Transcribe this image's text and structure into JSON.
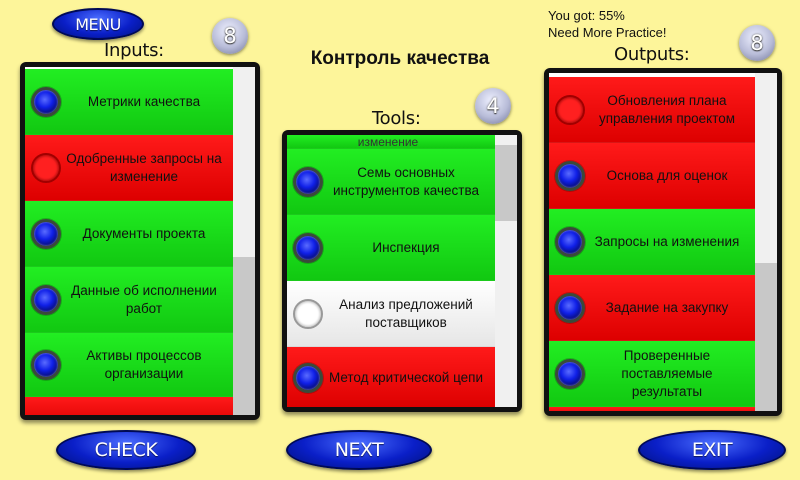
{
  "header": {
    "menu_label": "MENU",
    "title": "Контроль качества",
    "score_line": "You got: 55%",
    "feedback_line": "Need More Practice!"
  },
  "inputs": {
    "label": "Inputs:",
    "count": "8",
    "items": [
      {
        "label": "Метрики качества",
        "color": "green",
        "radio": "blue"
      },
      {
        "label": "Одобренные запросы на изменение",
        "color": "red",
        "radio": "empty-red"
      },
      {
        "label": "Документы проекта",
        "color": "green",
        "radio": "blue"
      },
      {
        "label": "Данные об исполнении работ",
        "color": "green",
        "radio": "blue"
      },
      {
        "label": "Активы процессов организации",
        "color": "green",
        "radio": "blue"
      }
    ]
  },
  "tools": {
    "label": "Tools:",
    "count": "4",
    "partial_top": "изменение",
    "items": [
      {
        "label": "Семь основных инструментов качества",
        "color": "green",
        "radio": "blue"
      },
      {
        "label": "Инспекция",
        "color": "green",
        "radio": "blue"
      },
      {
        "label": "Анализ предложений поставщиков",
        "color": "white",
        "radio": "empty-white"
      },
      {
        "label": "Метод критической цепи",
        "color": "red",
        "radio": "blue"
      }
    ]
  },
  "outputs": {
    "label": "Outputs:",
    "count": "8",
    "items": [
      {
        "label": "Обновления плана управления проектом",
        "color": "red",
        "radio": "empty-red"
      },
      {
        "label": "Основа для оценок",
        "color": "red",
        "radio": "blue"
      },
      {
        "label": "Запросы на изменения",
        "color": "green",
        "radio": "blue"
      },
      {
        "label": "Задание на закупку",
        "color": "red",
        "radio": "blue"
      },
      {
        "label": "Проверенные поставляемые результаты",
        "color": "green",
        "radio": "blue"
      }
    ]
  },
  "footer": {
    "check_label": "CHECK",
    "next_label": "NEXT",
    "exit_label": "EXIT"
  }
}
